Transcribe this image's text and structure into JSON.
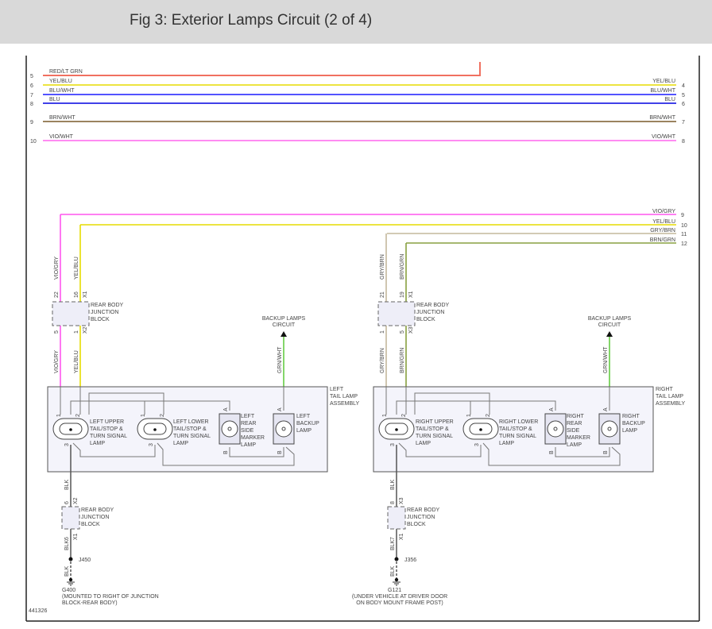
{
  "header": {
    "title": "Fig 3: Exterior Lamps Circuit (2 of 4)"
  },
  "diagram_id": "441326",
  "top_wires": [
    {
      "left_pin": "5",
      "label": "RED/LT GRN",
      "color": "#f07060",
      "right_pin": ""
    },
    {
      "left_pin": "6",
      "label": "YEL/BLU",
      "color": "#e6dc00",
      "right_pin": "4"
    },
    {
      "left_pin": "7",
      "label": "BLU/WHT",
      "color": "#1a1aff",
      "right_pin": "5"
    },
    {
      "left_pin": "8",
      "label": "BLU",
      "color": "#0000e0",
      "right_pin": "6"
    },
    {
      "left_pin": "9",
      "label": "BRN/WHT",
      "color": "#7a5a2a",
      "right_pin": "7"
    },
    {
      "left_pin": "10",
      "label": "VIO/WHT",
      "color": "#ff66ee",
      "right_pin": "8"
    }
  ],
  "feed_wires": [
    {
      "label": "VIO/GRY",
      "pin": "9",
      "color": "#ff55ee"
    },
    {
      "label": "YEL/BLU",
      "pin": "10",
      "color": "#e6dc00"
    },
    {
      "label": "GRY/BRN",
      "pin": "11",
      "color": "#c4b89c"
    },
    {
      "label": "BRN/GRN",
      "pin": "12",
      "color": "#88a040"
    }
  ],
  "sides": [
    {
      "wire_a": {
        "label": "VIO/GRY",
        "color": "#ff55ee"
      },
      "wire_b": {
        "label": "YEL/BLU",
        "color": "#e6dc00"
      },
      "jb_top": [
        "22",
        "16",
        "X1"
      ],
      "jb_bottom": [
        "5",
        "1",
        "X2"
      ],
      "jb_label": [
        "REAR BODY",
        "JUNCTION",
        "BLOCK"
      ],
      "backup_circuit": [
        "BACKUP LAMPS",
        "CIRCUIT"
      ],
      "backup_wire": {
        "label": "GRN/WHT",
        "color": "#66cc44"
      },
      "assembly_label": [
        "LEFT",
        "TAIL LAMP",
        "ASSEMBLY"
      ],
      "upper_lamp": [
        "LEFT UPPER",
        "TAIL/STOP &",
        "TURN SIGNAL",
        "LAMP"
      ],
      "lower_lamp": [
        "LEFT LOWER",
        "TAIL/STOP &",
        "TURN SIGNAL",
        "LAMP"
      ],
      "marker_lamp": [
        "LEFT",
        "REAR",
        "SIDE",
        "MARKER",
        "LAMP"
      ],
      "backup_lamp": [
        "LEFT",
        "BACKUP",
        "LAMP"
      ],
      "lamp_pins": {
        "p1": "1",
        "p2": "2",
        "p3": "3",
        "a": "A",
        "b": "B"
      },
      "ground_wire": "BLK",
      "gjb_top": [
        "6",
        "X2"
      ],
      "gjb_bottom": [
        "6",
        "X1"
      ],
      "gjb_label": [
        "REAR BODY",
        "JUNCTION",
        "BLOCK"
      ],
      "splice": "J450",
      "ground": "G400",
      "ground_desc": [
        "(MOUNTED TO RIGHT OF JUNCTION",
        "BLOCK-REAR BODY)"
      ]
    },
    {
      "wire_a": {
        "label": "GRY/BRN",
        "color": "#c4b89c"
      },
      "wire_b": {
        "label": "BRN/GRN",
        "color": "#88a040"
      },
      "jb_top": [
        "21",
        "19",
        "X1"
      ],
      "jb_bottom": [
        "1",
        "5",
        "X3"
      ],
      "jb_label": [
        "REAR BODY",
        "JUNCTION",
        "BLOCK"
      ],
      "backup_circuit": [
        "BACKUP LAMPS",
        "CIRCUIT"
      ],
      "backup_wire": {
        "label": "GRN/WHT",
        "color": "#66cc44"
      },
      "assembly_label": [
        "RIGHT",
        "TAIL LAMP",
        "ASSEMBLY"
      ],
      "upper_lamp": [
        "RIGHT UPPER",
        "TAIL/STOP &",
        "TURN SIGNAL",
        "LAMP"
      ],
      "lower_lamp": [
        "RIGHT LOWER",
        "TAIL/STOP &",
        "TURN SIGNAL",
        "LAMP"
      ],
      "marker_lamp": [
        "RIGHT",
        "REAR",
        "SIDE",
        "MARKER",
        "LAMP"
      ],
      "backup_lamp": [
        "RIGHT",
        "BACKUP",
        "LAMP"
      ],
      "lamp_pins": {
        "p1": "1",
        "p2": "2",
        "p3": "3",
        "a": "A",
        "b": "B"
      },
      "ground_wire": "BLK",
      "gjb_top": [
        "8",
        "X3"
      ],
      "gjb_bottom": [
        "7",
        "X1"
      ],
      "gjb_label": [
        "REAR BODY",
        "JUNCTION",
        "BLOCK"
      ],
      "splice": "J356",
      "ground": "G121",
      "ground_desc": [
        "(UNDER VEHICLE AT DRIVER DOOR",
        "ON BODY MOUNT FRAME POST)"
      ]
    }
  ]
}
